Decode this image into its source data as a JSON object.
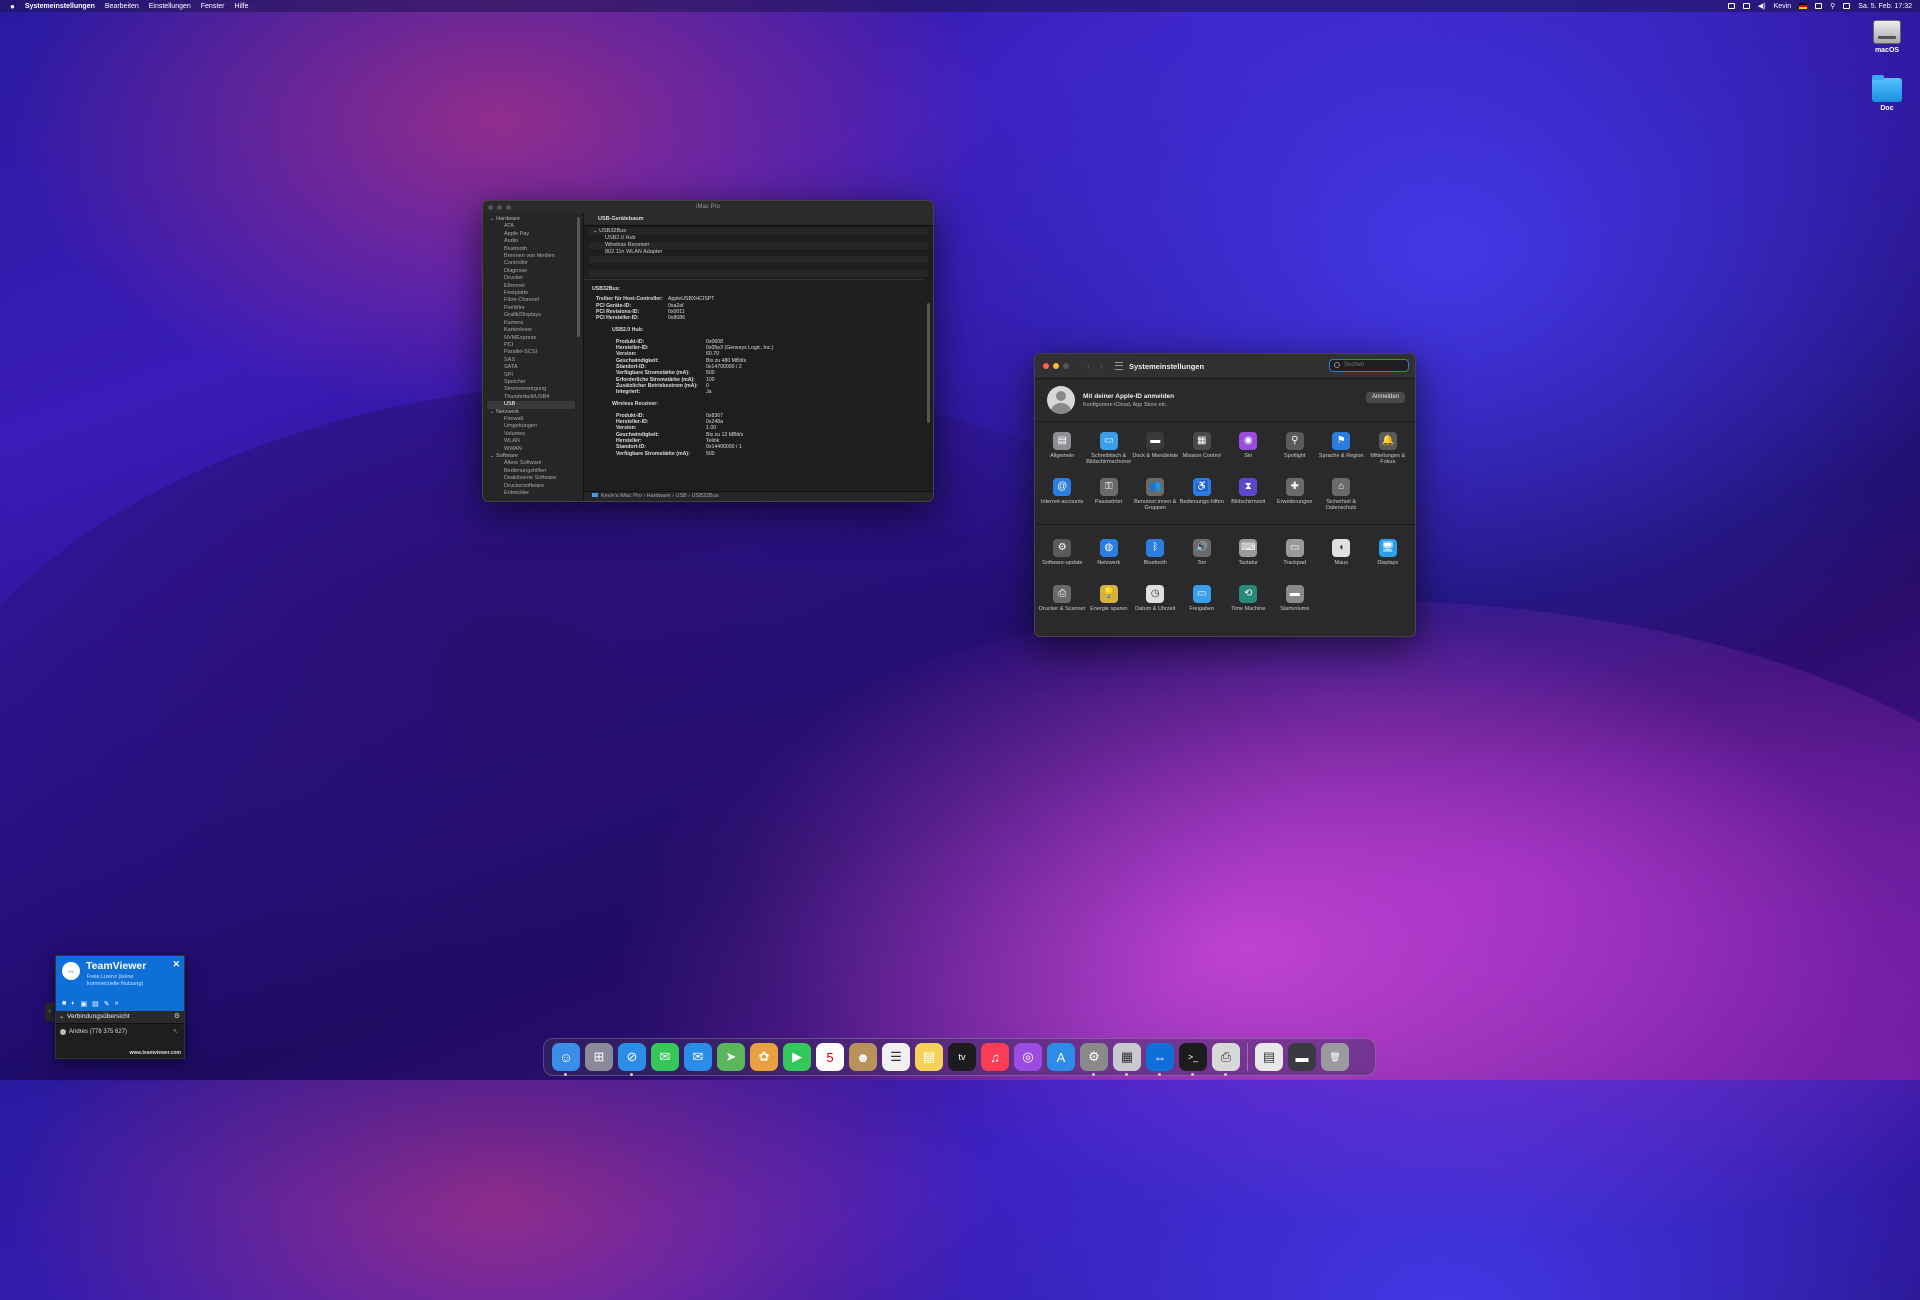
{
  "menubar": {
    "apple": "",
    "app_name": "Systemeinstellungen",
    "menus": [
      "Bearbeiten",
      "Einstellungen",
      "Fenster",
      "Hilfe"
    ],
    "user": "Kevin",
    "datetime": "Sa. 5. Feb. 17:32"
  },
  "desktop": {
    "icons": [
      {
        "label": "macOS"
      },
      {
        "label": "Doc"
      }
    ]
  },
  "sysinfo": {
    "window_title": "iMac Pro",
    "sidebar": {
      "hardware": {
        "label": "Hardware",
        "items": [
          "ATA",
          "Apple Pay",
          "Audio",
          "Bluetooth",
          "Brennen von Medien",
          "Controller",
          "Diagnose",
          "Drucker",
          "Ethernet",
          "Festplatte",
          "Fibre-Channel",
          "FireWire",
          "Grafik/Displays",
          "Kamera",
          "Kartenleser",
          "NVMExpress",
          "PCI",
          "Parallel-SCSI",
          "SAS",
          "SATA",
          "SPI",
          "Speicher",
          "Stromversorgung",
          "Thunderbolt/USB4",
          "USB"
        ]
      },
      "network": {
        "label": "Netzwerk",
        "items": [
          "Firewall",
          "Umgebungen",
          "Volumes",
          "WLAN",
          "WWAN"
        ]
      },
      "software": {
        "label": "Software",
        "items": [
          "Ältere Software",
          "Bedienungshilfen",
          "Deaktivierte Software",
          "Druckersoftware",
          "Entwickler"
        ]
      }
    },
    "tree_header": "USB-Gerätebaum",
    "tree": [
      "USB32Bus",
      "USB2.0 Hub",
      "Wireless Receiver",
      "802.11n WLAN Adapter"
    ],
    "detail": {
      "heading": "USB32Bus:",
      "bus": [
        {
          "k": "Treiber für Host-Controller:",
          "v": "AppleUSBXHCISPT"
        },
        {
          "k": "PCI Geräte-ID:",
          "v": "0xa2af"
        },
        {
          "k": "PCI Revisions-ID:",
          "v": "0x0011"
        },
        {
          "k": "PCI Hersteller-ID:",
          "v": "0x8086"
        }
      ],
      "hub_heading": "USB2.0 Hub:",
      "hub": [
        {
          "k": "Produkt-ID:",
          "v": "0x0608"
        },
        {
          "k": "Hersteller-ID:",
          "v": "0x05e3  (Genesys Logic, Inc.)"
        },
        {
          "k": "Version:",
          "v": "60.70"
        },
        {
          "k": "Geschwindigkeit:",
          "v": "Bis zu 480 MBit/s"
        },
        {
          "k": "Standort-ID:",
          "v": "0x14700000 / 2"
        },
        {
          "k": "Verfügbare Stromstärke (mA):",
          "v": "500"
        },
        {
          "k": "Erforderliche Stromstärke (mA):",
          "v": "100"
        },
        {
          "k": "Zusätzlicher Betriebsstrom (mA):",
          "v": "0"
        },
        {
          "k": "Integriert:",
          "v": "Ja"
        }
      ],
      "rx_heading": "Wireless Receiver:",
      "rx": [
        {
          "k": "Produkt-ID:",
          "v": "0x8367"
        },
        {
          "k": "Hersteller-ID:",
          "v": "0x248a"
        },
        {
          "k": "Version:",
          "v": "1.00"
        },
        {
          "k": "Geschwindigkeit:",
          "v": "Bis zu 12 MBit/s"
        },
        {
          "k": "Hersteller:",
          "v": "Telink"
        },
        {
          "k": "Standort-ID:",
          "v": "0x14400000 / 1"
        },
        {
          "k": "Verfügbare Stromstärke (mA):",
          "v": "500"
        }
      ]
    },
    "path": "Kevin's iMac Pro  ›  Hardware  ›  USB  ›  USB32Bus"
  },
  "syspref": {
    "title": "Systemeinstellungen",
    "search_placeholder": "Suchen",
    "appleid_title": "Mit deiner Apple-ID anmelden",
    "appleid_sub": "Konfiguriere iCloud, App Store etc.",
    "signin_label": "Anmelden",
    "section1": [
      {
        "label": "Allgemein",
        "icon": "general-icon",
        "color": "#8e8e93",
        "glyph": "▤"
      },
      {
        "label": "Schreibtisch & Bildschirmschoner",
        "icon": "desktop-icon",
        "color": "#3a9ee8",
        "glyph": "▭"
      },
      {
        "label": "Dock & Menüleiste",
        "icon": "dock-icon",
        "color": "#3a3a3c",
        "glyph": "▬"
      },
      {
        "label": "Mission Control",
        "icon": "mission-control-icon",
        "color": "#4a4a4c",
        "glyph": "▦"
      },
      {
        "label": "Siri",
        "icon": "siri-icon",
        "color": "#9b4de0",
        "glyph": "◉"
      },
      {
        "label": "Spotlight",
        "icon": "spotlight-icon",
        "color": "#5a5a5c",
        "glyph": "⚲"
      },
      {
        "label": "Sprache & Region",
        "icon": "language-icon",
        "color": "#2b7de0",
        "glyph": "⚑"
      },
      {
        "label": "Mitteilungen & Fokus",
        "icon": "notifications-icon",
        "color": "#5a5a5c",
        "glyph": "🔔"
      },
      {
        "label": "Internet-accounts",
        "icon": "internet-accounts-icon",
        "color": "#2b7de0",
        "glyph": "@"
      },
      {
        "label": "Passwörter",
        "icon": "passwords-icon",
        "color": "#6a6a6c",
        "glyph": "⚿"
      },
      {
        "label": "Benutzer:innen & Gruppen",
        "icon": "users-icon",
        "color": "#6a6a6c",
        "glyph": "👥"
      },
      {
        "label": "Bedienungs-hilfen",
        "icon": "accessibility-icon",
        "color": "#2b7de0",
        "glyph": "♿"
      },
      {
        "label": "Bildschirmzeit",
        "icon": "screen-time-icon",
        "color": "#5a48c8",
        "glyph": "⧗"
      },
      {
        "label": "Erweiterungen",
        "icon": "extensions-icon",
        "color": "#6a6a6c",
        "glyph": "✚"
      },
      {
        "label": "Sicherheit & Datenschutz",
        "icon": "security-icon",
        "color": "#6a6a6c",
        "glyph": "⌂"
      }
    ],
    "section2": [
      {
        "label": "Software-update",
        "icon": "software-update-icon",
        "color": "#5a5a5c",
        "glyph": "⚙"
      },
      {
        "label": "Netzwerk",
        "icon": "network-icon",
        "color": "#2b7de0",
        "glyph": "◍"
      },
      {
        "label": "Bluetooth",
        "icon": "bluetooth-icon",
        "color": "#2b7de0",
        "glyph": "ᛒ"
      },
      {
        "label": "Ton",
        "icon": "sound-icon",
        "color": "#6a6a6c",
        "glyph": "🔊"
      },
      {
        "label": "Tastatur",
        "icon": "keyboard-icon",
        "color": "#9a9a9c",
        "glyph": "⌨"
      },
      {
        "label": "Trackpad",
        "icon": "trackpad-icon",
        "color": "#9a9a9c",
        "glyph": "▭"
      },
      {
        "label": "Maus",
        "icon": "mouse-icon",
        "color": "#e0e0e0",
        "glyph": "◖"
      },
      {
        "label": "Displays",
        "icon": "displays-icon",
        "color": "#2b9ee8",
        "glyph": "🖥"
      },
      {
        "label": "Drucker & Scanner",
        "icon": "printer-icon",
        "color": "#6a6a6c",
        "glyph": "⎙"
      },
      {
        "label": "Energie sparen",
        "icon": "energy-icon",
        "color": "#d8b040",
        "glyph": "💡"
      },
      {
        "label": "Datum & Uhrzeit",
        "icon": "date-time-icon",
        "color": "#e0e0e0",
        "glyph": "◷"
      },
      {
        "label": "Freigaben",
        "icon": "sharing-icon",
        "color": "#3a9ee8",
        "glyph": "▭"
      },
      {
        "label": "Time Machine",
        "icon": "time-machine-icon",
        "color": "#2a8a7a",
        "glyph": "⟲"
      },
      {
        "label": "Startvolume",
        "icon": "startup-disk-icon",
        "color": "#8a8a8c",
        "glyph": "▬"
      }
    ]
  },
  "teamviewer": {
    "name": "TeamViewer",
    "license": "Freie Lizenz (keine kommerzielle Nutzung)",
    "section": "Verbindungsübersicht",
    "contact": "Andres (778 375 627)",
    "url": "www.teamviewer.com"
  },
  "dock": {
    "apps": [
      {
        "icon": "finder-icon",
        "color": "#3a8ee8",
        "glyph": "☺"
      },
      {
        "icon": "launchpad-icon",
        "color": "#8a8a9a",
        "glyph": "⊞"
      },
      {
        "icon": "safari-icon",
        "color": "#2b8de8",
        "glyph": "⊘"
      },
      {
        "icon": "messages-icon",
        "color": "#34c759",
        "glyph": "✉"
      },
      {
        "icon": "mail-icon",
        "color": "#2b8de8",
        "glyph": "✉"
      },
      {
        "icon": "maps-icon",
        "color": "#5ab75a",
        "glyph": "➤"
      },
      {
        "icon": "photos-icon",
        "color": "#e8a040",
        "glyph": "✿"
      },
      {
        "icon": "facetime-icon",
        "color": "#34c759",
        "glyph": "▶"
      },
      {
        "icon": "calendar-icon",
        "color": "#ffffff",
        "glyph": "5"
      },
      {
        "icon": "contacts-icon",
        "color": "#b8925a",
        "glyph": "☻"
      },
      {
        "icon": "reminders-icon",
        "color": "#f0f0f0",
        "glyph": "☰"
      },
      {
        "icon": "notes-icon",
        "color": "#f5d15a",
        "glyph": "▤"
      },
      {
        "icon": "tv-icon",
        "color": "#1c1c1e",
        "glyph": "tv"
      },
      {
        "icon": "music-icon",
        "color": "#fa3c55",
        "glyph": "♫"
      },
      {
        "icon": "podcasts-icon",
        "color": "#9a4de0",
        "glyph": "◎"
      },
      {
        "icon": "app-store-icon",
        "color": "#2b8de8",
        "glyph": "A"
      },
      {
        "icon": "system-preferences-icon",
        "color": "#8a8a8c",
        "glyph": "⚙"
      },
      {
        "icon": "system-information-icon",
        "color": "#c8c8d0",
        "glyph": "▦"
      },
      {
        "icon": "teamviewer-icon",
        "color": "#0e6fd8",
        "glyph": "⇔"
      },
      {
        "icon": "terminal-icon",
        "color": "#1c1c1e",
        "glyph": ">_"
      },
      {
        "icon": "preview-icon",
        "color": "#d8d8d8",
        "glyph": "⎙"
      }
    ],
    "right": [
      {
        "icon": "document-icon",
        "color": "#e8e8e8",
        "glyph": "▤"
      },
      {
        "icon": "screenshot-folder-icon",
        "color": "#3a3a44",
        "glyph": "▬"
      },
      {
        "icon": "trash-icon",
        "color": "#9a9aa0",
        "glyph": "🗑"
      }
    ]
  }
}
